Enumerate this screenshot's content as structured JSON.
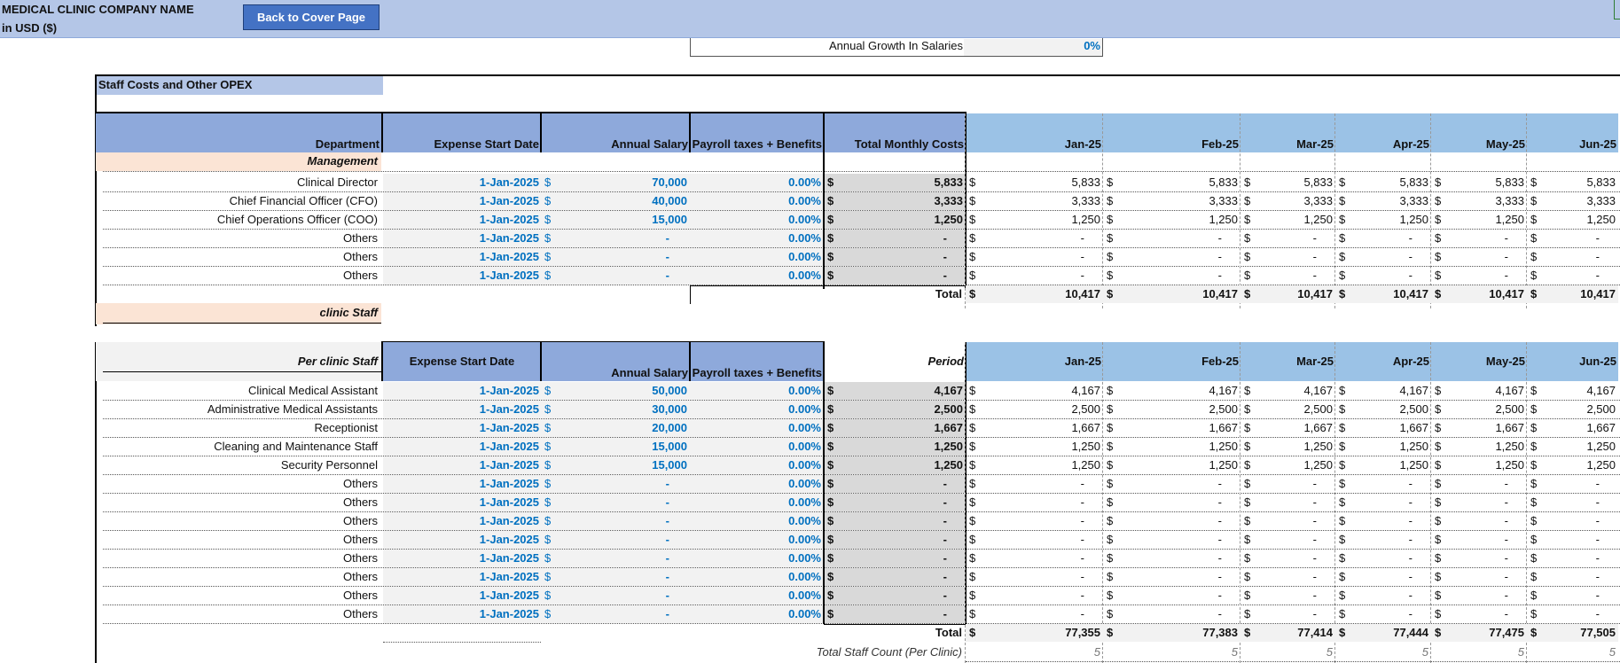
{
  "header": {
    "company": "MEDICAL CLINIC COMPANY NAME",
    "currency": "in USD ($)",
    "cover_button": "Back to Cover Page"
  },
  "growth": {
    "label": "Annual Growth In Salaries",
    "value": "0%"
  },
  "section_title": "Staff Costs and Other OPEX",
  "months": [
    "Jan-25",
    "Feb-25",
    "Mar-25",
    "Apr-25",
    "May-25",
    "Jun-25"
  ],
  "management": {
    "headers": {
      "department": "Department",
      "start_date": "Expense Start Date",
      "salary": "Annual Salary",
      "payroll": "Payroll taxes + Benefits",
      "monthly": "Total Monthly Costs"
    },
    "group_label": "Management",
    "rows": [
      {
        "name": "Clinical Director",
        "date": "1-Jan-2025",
        "salary": "70,000",
        "payroll": "0.00%",
        "monthly": "5,833",
        "months": [
          "5,833",
          "5,833",
          "5,833",
          "5,833",
          "5,833",
          "5,833"
        ]
      },
      {
        "name": "Chief Financial Officer (CFO)",
        "date": "1-Jan-2025",
        "salary": "40,000",
        "payroll": "0.00%",
        "monthly": "3,333",
        "months": [
          "3,333",
          "3,333",
          "3,333",
          "3,333",
          "3,333",
          "3,333"
        ]
      },
      {
        "name": "Chief Operations Officer (COO)",
        "date": "1-Jan-2025",
        "salary": "15,000",
        "payroll": "0.00%",
        "monthly": "1,250",
        "months": [
          "1,250",
          "1,250",
          "1,250",
          "1,250",
          "1,250",
          "1,250"
        ]
      },
      {
        "name": "Others",
        "date": "1-Jan-2025",
        "salary": "-",
        "payroll": "0.00%",
        "monthly": "-",
        "months": [
          "-",
          "-",
          "-",
          "-",
          "-",
          "-"
        ]
      },
      {
        "name": "Others",
        "date": "1-Jan-2025",
        "salary": "-",
        "payroll": "0.00%",
        "monthly": "-",
        "months": [
          "-",
          "-",
          "-",
          "-",
          "-",
          "-"
        ]
      },
      {
        "name": "Others",
        "date": "1-Jan-2025",
        "salary": "-",
        "payroll": "0.00%",
        "monthly": "-",
        "months": [
          "-",
          "-",
          "-",
          "-",
          "-",
          "-"
        ]
      }
    ],
    "total_label": "Total",
    "totals": [
      "10,417",
      "10,417",
      "10,417",
      "10,417",
      "10,417",
      "10,417"
    ]
  },
  "clinic_staff_label": "clinic Staff",
  "clinic": {
    "headers": {
      "group": "Per clinic Staff",
      "start_date": "Expense Start Date",
      "salary": "Annual Salary",
      "payroll": "Payroll taxes + Benefits",
      "period": "Period"
    },
    "rows": [
      {
        "name": "Clinical Medical Assistant",
        "date": "1-Jan-2025",
        "salary": "50,000",
        "payroll": "0.00%",
        "monthly": "4,167",
        "months": [
          "4,167",
          "4,167",
          "4,167",
          "4,167",
          "4,167",
          "4,167"
        ]
      },
      {
        "name": "Administrative Medical Assistants",
        "date": "1-Jan-2025",
        "salary": "30,000",
        "payroll": "0.00%",
        "monthly": "2,500",
        "months": [
          "2,500",
          "2,500",
          "2,500",
          "2,500",
          "2,500",
          "2,500"
        ]
      },
      {
        "name": "Receptionist",
        "date": "1-Jan-2025",
        "salary": "20,000",
        "payroll": "0.00%",
        "monthly": "1,667",
        "months": [
          "1,667",
          "1,667",
          "1,667",
          "1,667",
          "1,667",
          "1,667"
        ]
      },
      {
        "name": "Cleaning and Maintenance Staff",
        "date": "1-Jan-2025",
        "salary": "15,000",
        "payroll": "0.00%",
        "monthly": "1,250",
        "months": [
          "1,250",
          "1,250",
          "1,250",
          "1,250",
          "1,250",
          "1,250"
        ]
      },
      {
        "name": "Security Personnel",
        "date": "1-Jan-2025",
        "salary": "15,000",
        "payroll": "0.00%",
        "monthly": "1,250",
        "months": [
          "1,250",
          "1,250",
          "1,250",
          "1,250",
          "1,250",
          "1,250"
        ]
      },
      {
        "name": "Others",
        "date": "1-Jan-2025",
        "salary": "-",
        "payroll": "0.00%",
        "monthly": "-",
        "months": [
          "-",
          "-",
          "-",
          "-",
          "-",
          "-"
        ]
      },
      {
        "name": "Others",
        "date": "1-Jan-2025",
        "salary": "-",
        "payroll": "0.00%",
        "monthly": "-",
        "months": [
          "-",
          "-",
          "-",
          "-",
          "-",
          "-"
        ]
      },
      {
        "name": "Others",
        "date": "1-Jan-2025",
        "salary": "-",
        "payroll": "0.00%",
        "monthly": "-",
        "months": [
          "-",
          "-",
          "-",
          "-",
          "-",
          "-"
        ]
      },
      {
        "name": "Others",
        "date": "1-Jan-2025",
        "salary": "-",
        "payroll": "0.00%",
        "monthly": "-",
        "months": [
          "-",
          "-",
          "-",
          "-",
          "-",
          "-"
        ]
      },
      {
        "name": "Others",
        "date": "1-Jan-2025",
        "salary": "-",
        "payroll": "0.00%",
        "monthly": "-",
        "months": [
          "-",
          "-",
          "-",
          "-",
          "-",
          "-"
        ]
      },
      {
        "name": "Others",
        "date": "1-Jan-2025",
        "salary": "-",
        "payroll": "0.00%",
        "monthly": "-",
        "months": [
          "-",
          "-",
          "-",
          "-",
          "-",
          "-"
        ]
      },
      {
        "name": "Others",
        "date": "1-Jan-2025",
        "salary": "-",
        "payroll": "0.00%",
        "monthly": "-",
        "months": [
          "-",
          "-",
          "-",
          "-",
          "-",
          "-"
        ]
      },
      {
        "name": "Others",
        "date": "1-Jan-2025",
        "salary": "-",
        "payroll": "0.00%",
        "monthly": "-",
        "months": [
          "-",
          "-",
          "-",
          "-",
          "-",
          "-"
        ]
      }
    ],
    "total_label": "Total",
    "totals": [
      "77,355",
      "77,383",
      "77,414",
      "77,444",
      "77,475",
      "77,505"
    ],
    "count_label": "Total Staff Count (Per Clinic)",
    "counts": [
      "5",
      "5",
      "5",
      "5",
      "5",
      "5"
    ]
  },
  "currency_symbol": "$"
}
